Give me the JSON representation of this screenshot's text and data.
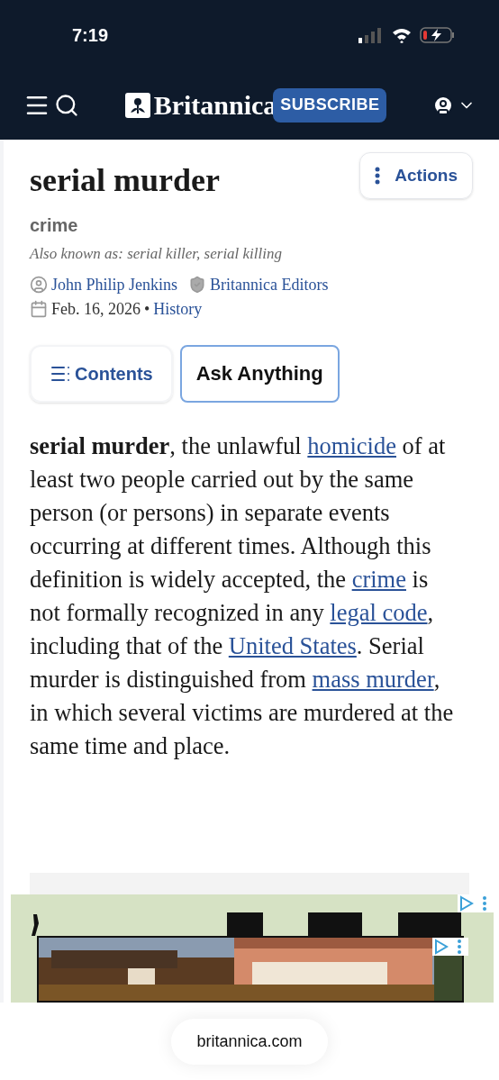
{
  "status_bar": {
    "time": "7:19"
  },
  "nav": {
    "logo": "Britannica",
    "subscribe": "SUBSCRIBE"
  },
  "article": {
    "title": "serial murder",
    "actions": "Actions",
    "category": "crime",
    "also_known": "Also known as: serial killer, serial killing",
    "authors": [
      {
        "kind": "person",
        "name": "John Philip Jenkins"
      },
      {
        "kind": "editors",
        "name": "Britannica Editors"
      }
    ],
    "date": "Feb. 16, 2026",
    "separator": "•",
    "topic": "History",
    "buttons": [
      {
        "kind": "contents",
        "label": "Contents"
      },
      {
        "kind": "ask",
        "label": "Ask Anything"
      }
    ],
    "paragraph": [
      {
        "kind": "text",
        "text": "**serial murder**, the unlawful "
      },
      {
        "kind": "link",
        "text": "homicide"
      },
      {
        "kind": "text",
        "text": " of at least two people carried out by the same person (or persons) in separate events occurring at different times. Although this definition is widely accepted, the "
      },
      {
        "kind": "link",
        "text": "crime"
      },
      {
        "kind": "text",
        "text": " is not formally recognized in any "
      },
      {
        "kind": "link",
        "text": "legal code"
      },
      {
        "kind": "text",
        "text": ", including that of the "
      },
      {
        "kind": "link",
        "text": "United States"
      },
      {
        "kind": "text",
        "text": ". Serial murder is distinguished from "
      },
      {
        "kind": "link",
        "text": "mass murder"
      },
      {
        "kind": "text",
        "text": ", in which several victims are murdered at the same time and place."
      }
    ]
  },
  "address_bar": {
    "url": "britannica.com"
  }
}
